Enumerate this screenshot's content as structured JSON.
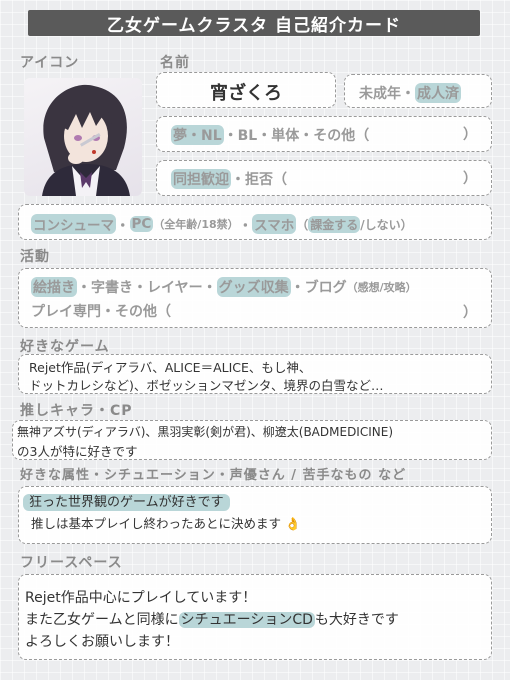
{
  "title": "乙女ゲームクラスタ 自己紹介カード",
  "labels": {
    "icon": "アイコン",
    "name": "名前",
    "activity": "活動",
    "favorite_games": "好きなゲーム",
    "oshi": "推しキャラ・CP",
    "likes": "好きな属性・シチュエーション・声優さん / 苦手なもの など",
    "free_space": "フリースペース"
  },
  "name": "宵ざくろ",
  "age": {
    "minor": "未成年",
    "sep": "・",
    "adult": "成人済"
  },
  "genre": {
    "yume": "夢・NL",
    "rest": "・BL・単体・その他（",
    "close": "）"
  },
  "same_char": {
    "ok": "同担歓迎",
    "rest": "・拒否（",
    "close": "）"
  },
  "platform": {
    "consumer": "コンシューマ",
    "dot1": "・",
    "pc": "PC",
    "pc_note": "（全年齢/18禁）",
    "dot2": "・",
    "phone": "スマホ",
    "kakin_open": "（",
    "kakin_yes": "課金する",
    "kakin_rest": "/しない）"
  },
  "activity": {
    "art": "絵描き",
    "row1_mid": "・字書き・レイヤー・",
    "goods": "グッズ収集",
    "row1_end": "・ブログ",
    "blog_note": "（感想/攻略）",
    "row2": "プレイ専門・その他（",
    "close": "）"
  },
  "favorite_games": [
    "Rejet作品(ディアラバ、ALICE＝ALICE、もし神、",
    "ドットカレシなど)、ボゼッションマゼンタ、境界の白雪など…"
  ],
  "oshi": [
    "無神アズサ(ディアラバ)、黒羽実彰(剣が君)、柳遼太(BADMEDICINE)",
    "の3人が特に好きです"
  ],
  "likes": {
    "line1": "狂った世界観のゲームが好きです",
    "line2": "推しは基本プレイし終わったあとに決めます",
    "emoji": "👌"
  },
  "free_space": {
    "line1": "Rejet作品中心にプレイしています！",
    "line2_a": "また乙女ゲームと同様に",
    "line2_hl": "シチュエーションCD",
    "line2_b": "も大好きです",
    "line3": "よろしくお願いします！"
  },
  "colors": {
    "highlight": "#b9d6d8",
    "banner": "#5a5a5a",
    "label": "#8a8a8a"
  }
}
